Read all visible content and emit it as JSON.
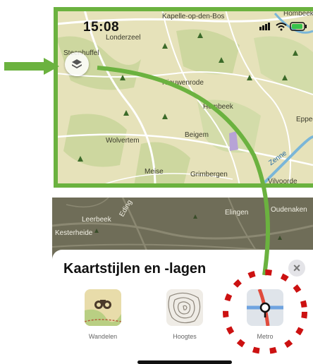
{
  "status_bar": {
    "time": "15:08"
  },
  "map_top": {
    "places": {
      "kapelle": "Kapelle-op-den-Bos",
      "hombeek": "Hombeek",
      "londerzeel": "Londerzeel",
      "steenhuffel": "Steenhuffel",
      "nieuwenrode": "Nieuwenrode",
      "hombeek2": "Hombeek",
      "eppeg": "Eppeg",
      "beigem": "Beigem",
      "wolvertem": "Wolvertem",
      "meise": "Meise",
      "grimbergen": "Grimbergen",
      "vilvoorde": "Vilvoorde",
      "zenne": "Zenne"
    }
  },
  "map_bottom": {
    "places": {
      "elingen": "Elingen",
      "oudenaken": "Oudenaken",
      "leerbeek": "Leerbeek",
      "kesterheide": "Kesterheide",
      "eding": "Eding"
    }
  },
  "sheet": {
    "title": "Kaartstijlen en -lagen",
    "close_glyph": "×",
    "tiles": [
      {
        "label": "Wandelen",
        "icon": "binoculars-trail-icon"
      },
      {
        "label": "Hoogtes",
        "icon": "contour-lines-icon"
      },
      {
        "label": "Metro",
        "icon": "metro-station-icon"
      }
    ]
  },
  "colors": {
    "highlight_green": "#6bb23f",
    "annotation_red": "#cc1111",
    "map_yellow": "#e6e2ba",
    "map_forest": "#c8d49a"
  }
}
